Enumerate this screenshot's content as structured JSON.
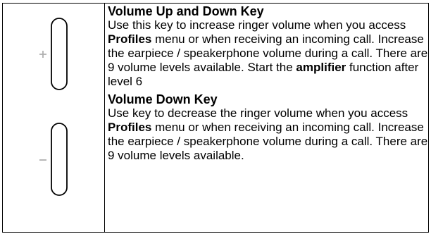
{
  "icons": {
    "volume_up_key": "volume-up-side-key-icon",
    "volume_down_key": "volume-down-side-key-icon",
    "plus_sign": "plus-icon",
    "minus_sign": "minus-icon"
  },
  "colors": {
    "border": "#000000",
    "key_outline": "#000000",
    "sign_gray": "#b0b0b0"
  },
  "sections": [
    {
      "title": "Volume Up and Down Key",
      "body": {
        "p1": "Use this key to increase ringer volume when you access ",
        "b1": "Profiles",
        "p2": " menu or when receiving an incoming call. Increase the earpiece / speakerphone volume during a call. There are 9 volume levels available. Start the ",
        "b2": "amplifier",
        "p3": " function after level 6"
      }
    },
    {
      "title": "Volume Down Key",
      "body": {
        "p1": "Use key to decrease the ringer volume when you access ",
        "b1": "Profiles",
        "p2": " menu or when receiving an incoming call. Increase the earpiece / speakerphone volume during a call. There are 9 volume levels available."
      }
    }
  ]
}
